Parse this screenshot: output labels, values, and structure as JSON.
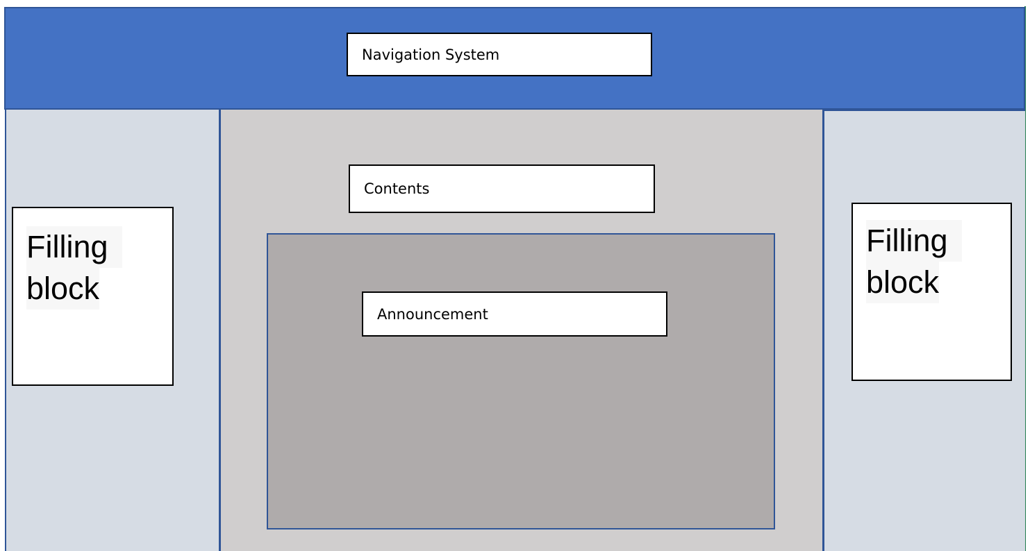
{
  "header": {
    "nav_label": "Navigation System",
    "background_color": "#4472c4"
  },
  "main": {
    "contents_label": "Contents",
    "announcement_label": "Announcement",
    "background_color": "#d0cece",
    "announcement_area_color": "#afabab"
  },
  "left_sidebar": {
    "line1": "Filling",
    "line2": "block",
    "background_color": "#d6dce4"
  },
  "right_sidebar": {
    "line1": "Filling",
    "line2": "block",
    "background_color": "#d6dce4"
  },
  "accent_border_color": "#2f5597"
}
